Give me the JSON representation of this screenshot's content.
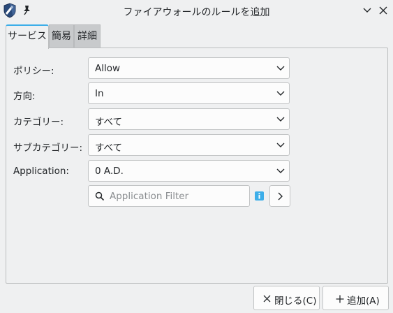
{
  "window": {
    "title": "ファイアウォールのルールを追加"
  },
  "tabs": [
    {
      "label": "サービス",
      "active": true
    },
    {
      "label": "簡易",
      "active": false
    },
    {
      "label": "詳細",
      "active": false
    }
  ],
  "form": {
    "policy": {
      "label": "ポリシー:",
      "value": "Allow"
    },
    "direction": {
      "label": "方向:",
      "value": "In"
    },
    "category": {
      "label": "カテゴリー:",
      "value": "すべて"
    },
    "subcategory": {
      "label": "サブカテゴリー:",
      "value": "すべて"
    },
    "application": {
      "label": "Application:",
      "value": "0 A.D."
    },
    "filter": {
      "placeholder": "Application Filter",
      "value": ""
    }
  },
  "buttons": {
    "close": "閉じる(C)",
    "add": "追加(A)"
  },
  "colors": {
    "accent": "#3daee9",
    "window_bg": "#eff0f1",
    "field_bg": "#fcfcfc"
  }
}
